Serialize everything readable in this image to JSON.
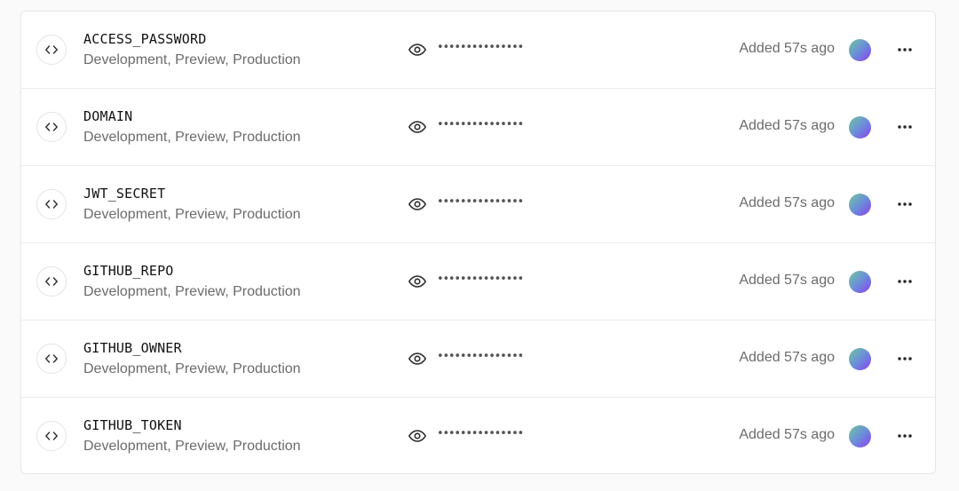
{
  "colors": {
    "avatar_gradient": [
      "#74c69d",
      "#6a8fd8",
      "#8b3ff0"
    ],
    "text_primary": "#111111",
    "text_secondary": "#6b6b6b"
  },
  "icons": {
    "badge": "code-brackets-icon",
    "reveal": "eye-icon",
    "menu": "more-horizontal-icon"
  },
  "variables": [
    {
      "name": "ACCESS_PASSWORD",
      "environments": "Development, Preview, Production",
      "value_masked": "•••••••••••••••",
      "added": "Added 57s ago"
    },
    {
      "name": "DOMAIN",
      "environments": "Development, Preview, Production",
      "value_masked": "•••••••••••••••",
      "added": "Added 57s ago"
    },
    {
      "name": "JWT_SECRET",
      "environments": "Development, Preview, Production",
      "value_masked": "•••••••••••••••",
      "added": "Added 57s ago"
    },
    {
      "name": "GITHUB_REPO",
      "environments": "Development, Preview, Production",
      "value_masked": "•••••••••••••••",
      "added": "Added 57s ago"
    },
    {
      "name": "GITHUB_OWNER",
      "environments": "Development, Preview, Production",
      "value_masked": "•••••••••••••••",
      "added": "Added 57s ago"
    },
    {
      "name": "GITHUB_TOKEN",
      "environments": "Development, Preview, Production",
      "value_masked": "•••••••••••••••",
      "added": "Added 57s ago"
    }
  ]
}
